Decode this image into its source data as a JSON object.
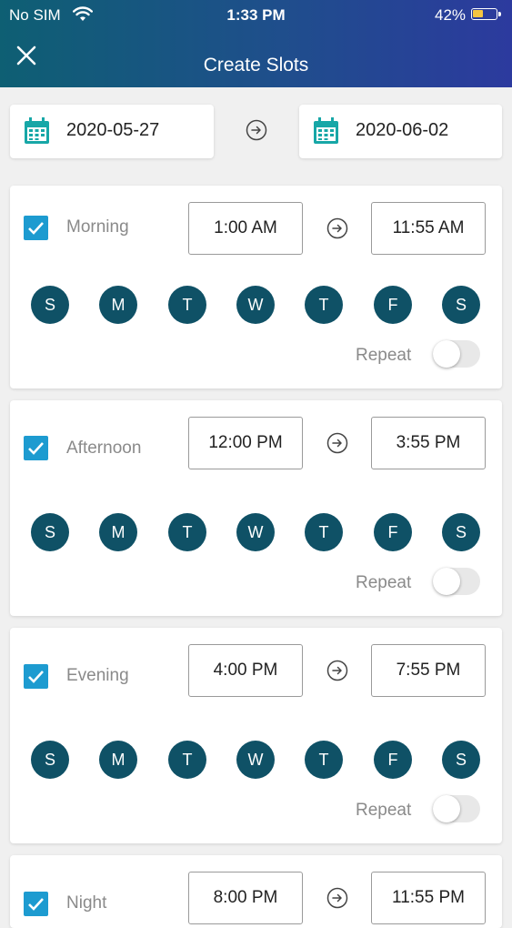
{
  "status_bar": {
    "carrier": "No SIM",
    "time": "1:33 PM",
    "battery_percent": "42%",
    "battery_level": 0.42
  },
  "header": {
    "title": "Create Slots",
    "close_icon": "close-icon"
  },
  "date_range": {
    "start": "2020-05-27",
    "end": "2020-06-02"
  },
  "colors": {
    "header_start": "#0e5f73",
    "header_end": "#2c3a9e",
    "day_circle": "#0f5166",
    "checkbox": "#1d9bd0",
    "calendar_icon": "#17a7a7"
  },
  "slots": [
    {
      "label": "Morning",
      "checked": true,
      "start": "1:00 AM",
      "end": "11:55 AM",
      "days": [
        "S",
        "M",
        "T",
        "W",
        "T",
        "F",
        "S"
      ],
      "repeat_label": "Repeat",
      "repeat": false
    },
    {
      "label": "Afternoon",
      "checked": true,
      "start": "12:00 PM",
      "end": "3:55 PM",
      "days": [
        "S",
        "M",
        "T",
        "W",
        "T",
        "F",
        "S"
      ],
      "repeat_label": "Repeat",
      "repeat": false
    },
    {
      "label": "Evening",
      "checked": true,
      "start": "4:00 PM",
      "end": "7:55 PM",
      "days": [
        "S",
        "M",
        "T",
        "W",
        "T",
        "F",
        "S"
      ],
      "repeat_label": "Repeat",
      "repeat": false
    },
    {
      "label": "Night",
      "checked": true,
      "start": "8:00 PM",
      "end": "11:55 PM"
    }
  ]
}
